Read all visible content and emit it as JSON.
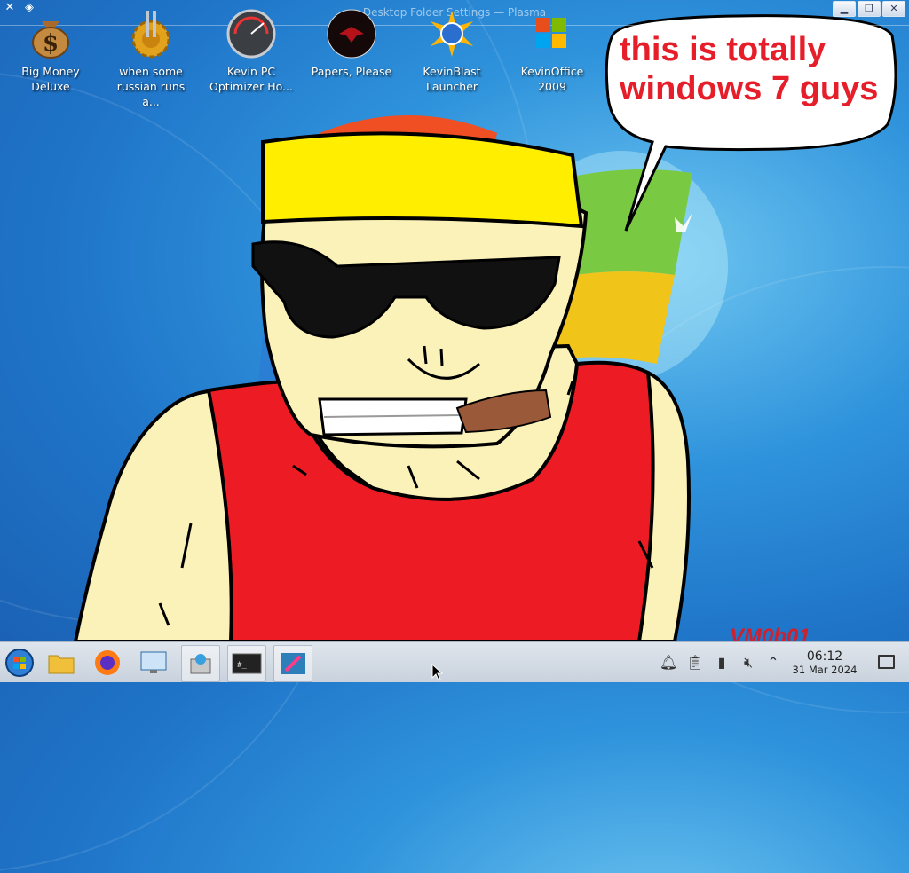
{
  "window": {
    "title": "Desktop Folder Settings — Plasma"
  },
  "desktop_icons": [
    {
      "label": "Big Money Deluxe"
    },
    {
      "label": "when some russian runs a..."
    },
    {
      "label": "Kevin PC Optimizer Ho..."
    },
    {
      "label": "Papers, Please"
    },
    {
      "label": "KevinBlast Launcher"
    },
    {
      "label": "KevinOffice 2009"
    }
  ],
  "speech_bubble": {
    "line1": "this is totally",
    "line2": "windows 7 guys"
  },
  "watermark": "VM0b01",
  "taskbar": {
    "apps": [
      "start-orb-icon",
      "file-manager-icon",
      "firefox-icon",
      "settings-icon",
      "package-icon",
      "terminal-icon",
      "color-picker-icon"
    ],
    "tray": [
      "notification-bell-icon",
      "clipboard-icon",
      "battery-icon",
      "volume-muted-icon",
      "chevron-up-icon"
    ],
    "clock": {
      "time": "06:12",
      "date": "31 Mar 2024"
    }
  },
  "colors": {
    "bubble_text": "#e61e2a",
    "tank_top": "#ed1c24",
    "bandana": "#ffee00",
    "skin": "#fbf2b9"
  }
}
